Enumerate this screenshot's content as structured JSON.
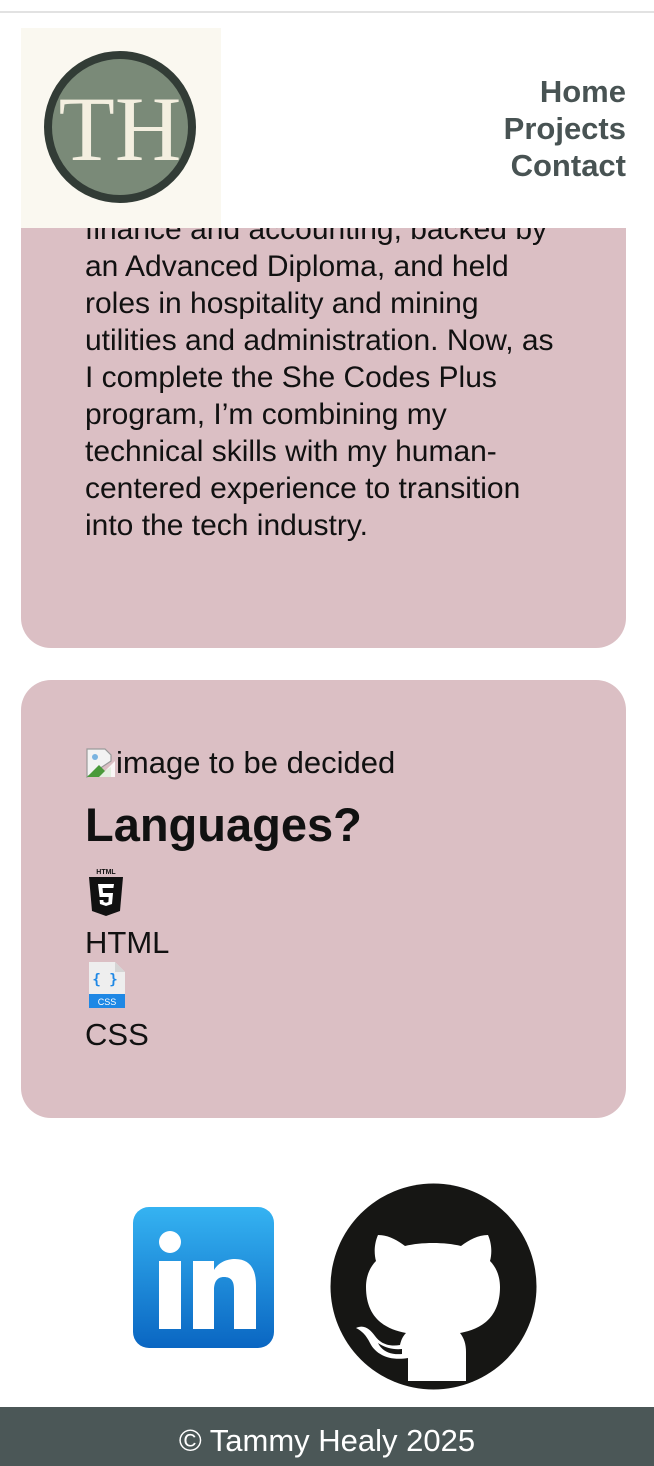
{
  "header": {
    "logo_text": "TH",
    "nav": [
      {
        "label": "Home"
      },
      {
        "label": "Projects"
      },
      {
        "label": "Contact"
      }
    ]
  },
  "about": {
    "text": "finance and accounting, backed by an Advanced Diploma, and held roles in hospitality and mining utilities and administration. Now, as I complete the She Codes Plus program, I’m combining my technical skills with my human-centered experience to transition into the tech industry."
  },
  "languages": {
    "image_alt": "image to be decided",
    "title": "Languages?",
    "items": [
      {
        "label": "HTML",
        "icon": "html5-icon"
      },
      {
        "label": "CSS",
        "icon": "css-file-icon"
      }
    ]
  },
  "social": [
    {
      "name": "LinkedIn",
      "icon": "linkedin-icon"
    },
    {
      "name": "GitHub",
      "icon": "github-icon"
    }
  ],
  "footer": {
    "text": "© Tammy Healy 2025"
  },
  "colors": {
    "card_bg": "#dbbfc4",
    "nav_text": "#485353",
    "footer_bg": "#4b5757",
    "logo_bg": "#faf8f0",
    "logo_circle": "#7a8a78",
    "logo_ring": "#323c36"
  }
}
